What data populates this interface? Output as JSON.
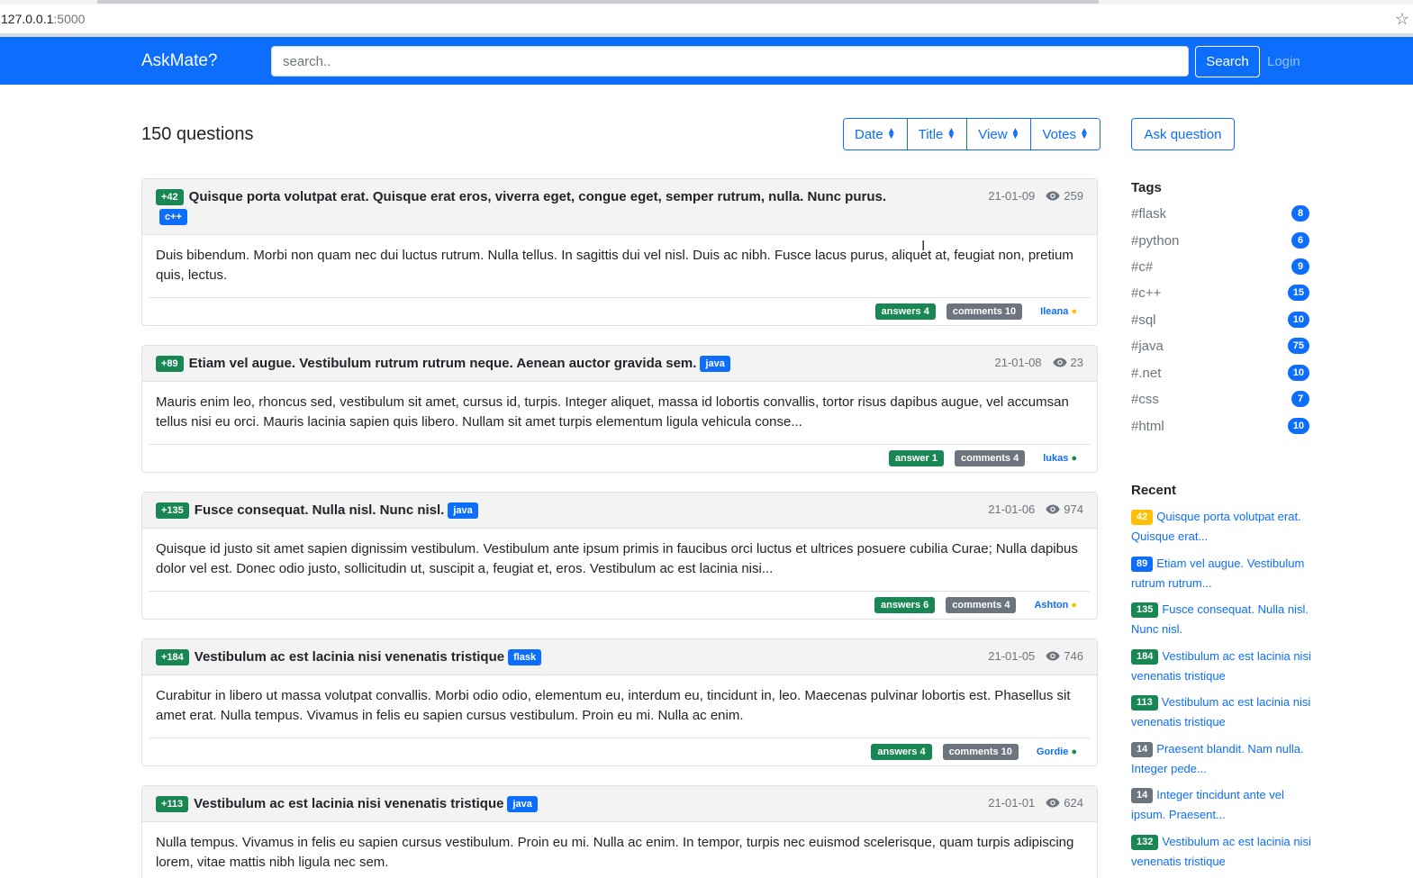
{
  "browser": {
    "url_host": "127.0.0.1",
    "url_port": ":5000"
  },
  "navbar": {
    "brand": "AskMate?",
    "search_placeholder": "search..",
    "search_button": "Search",
    "login": "Login"
  },
  "header": {
    "question_count": "150 questions",
    "sort_buttons": [
      "Date",
      "Title",
      "View",
      "Votes"
    ],
    "ask_button": "Ask question"
  },
  "questions": [
    {
      "votes": "+42",
      "title": "Quisque porta volutpat erat. Quisque erat eros, viverra eget, congue eget, semper rutrum, nulla. Nunc purus.",
      "tag": "c++",
      "date": "21-01-09",
      "views": "259",
      "body": "Duis bibendum. Morbi non quam nec dui luctus rutrum. Nulla tellus. In sagittis dui vel nisl. Duis ac nibh. Fusce lacus purus, aliquet at, feugiat non, pretium quis, lectus.",
      "answers": "answers 4",
      "comments": "comments 10",
      "author": "Ileana",
      "status_color": "#ffc107"
    },
    {
      "votes": "+89",
      "title": "Etiam vel augue. Vestibulum rutrum rutrum neque. Aenean auctor gravida sem.",
      "tag": "java",
      "date": "21-01-08",
      "views": "23",
      "body": "Mauris enim leo, rhoncus sed, vestibulum sit amet, cursus id, turpis. Integer aliquet, massa id lobortis convallis, tortor risus dapibus augue, vel accumsan tellus nisi eu orci. Mauris lacinia sapien quis libero. Nullam sit amet turpis elementum ligula vehicula conse...",
      "answers": "answer 1",
      "comments": "comments 4",
      "author": "lukas",
      "status_color": "#198754"
    },
    {
      "votes": "+135",
      "title": "Fusce consequat. Nulla nisl. Nunc nisl.",
      "tag": "java",
      "date": "21-01-06",
      "views": "974",
      "body": "Quisque id justo sit amet sapien dignissim vestibulum. Vestibulum ante ipsum primis in faucibus orci luctus et ultrices posuere cubilia Curae; Nulla dapibus dolor vel est. Donec odio justo, sollicitudin ut, suscipit a, feugiat et, eros. Vestibulum ac est lacinia nisi...",
      "answers": "answers 6",
      "comments": "comments 4",
      "author": "Ashton",
      "status_color": "#ffc107"
    },
    {
      "votes": "+184",
      "title": "Vestibulum ac est lacinia nisi venenatis tristique",
      "tag": "flask",
      "date": "21-01-05",
      "views": "746",
      "body": "Curabitur in libero ut massa volutpat convallis. Morbi odio odio, elementum eu, interdum eu, tincidunt in, leo. Maecenas pulvinar lobortis est. Phasellus sit amet erat. Nulla tempus. Vivamus in felis eu sapien cursus vestibulum. Proin eu mi. Nulla ac enim.",
      "answers": "answers 4",
      "comments": "comments 10",
      "author": "Gordie",
      "status_color": "#198754"
    },
    {
      "votes": "+113",
      "title": "Vestibulum ac est lacinia nisi venenatis tristique",
      "tag": "java",
      "date": "21-01-01",
      "views": "624",
      "body": "Nulla tempus. Vivamus in felis eu sapien cursus vestibulum. Proin eu mi. Nulla ac enim. In tempor, turpis nec euismod scelerisque, quam turpis adipiscing lorem, vitae mattis nibh ligula nec sem."
    }
  ],
  "sidebar": {
    "tags_heading": "Tags",
    "tags": [
      {
        "name": "#flask",
        "count": "8"
      },
      {
        "name": "#python",
        "count": "6"
      },
      {
        "name": "#c#",
        "count": "9"
      },
      {
        "name": "#c++",
        "count": "15"
      },
      {
        "name": "#sql",
        "count": "10"
      },
      {
        "name": "#java",
        "count": "75"
      },
      {
        "name": "#.net",
        "count": "10"
      },
      {
        "name": "#css",
        "count": "7"
      },
      {
        "name": "#html",
        "count": "10"
      }
    ],
    "recent_heading": "Recent",
    "recent": [
      {
        "votes": "42",
        "title": "Quisque porta volutpat erat. Quisque erat...",
        "color": "yellow"
      },
      {
        "votes": "89",
        "title": "Etiam vel augue. Vestibulum rutrum rutrum...",
        "color": "blue"
      },
      {
        "votes": "135",
        "title": "Fusce consequat. Nulla nisl. Nunc nisl.",
        "color": "green"
      },
      {
        "votes": "184",
        "title": "Vestibulum ac est lacinia nisi venenatis tristique",
        "color": "green"
      },
      {
        "votes": "113",
        "title": "Vestibulum ac est lacinia nisi venenatis tristique",
        "color": "green"
      },
      {
        "votes": "14",
        "title": "Praesent blandit. Nam nulla. Integer pede...",
        "color": "gray"
      },
      {
        "votes": "14",
        "title": "Integer tincidunt ante vel ipsum. Praesent...",
        "color": "gray"
      },
      {
        "votes": "132",
        "title": "Vestibulum ac est lacinia nisi venenatis tristique",
        "color": "green"
      }
    ]
  },
  "colors": {
    "primary": "#0d6efd",
    "success": "#198754",
    "secondary": "#6c757d",
    "warning": "#ffc107"
  }
}
